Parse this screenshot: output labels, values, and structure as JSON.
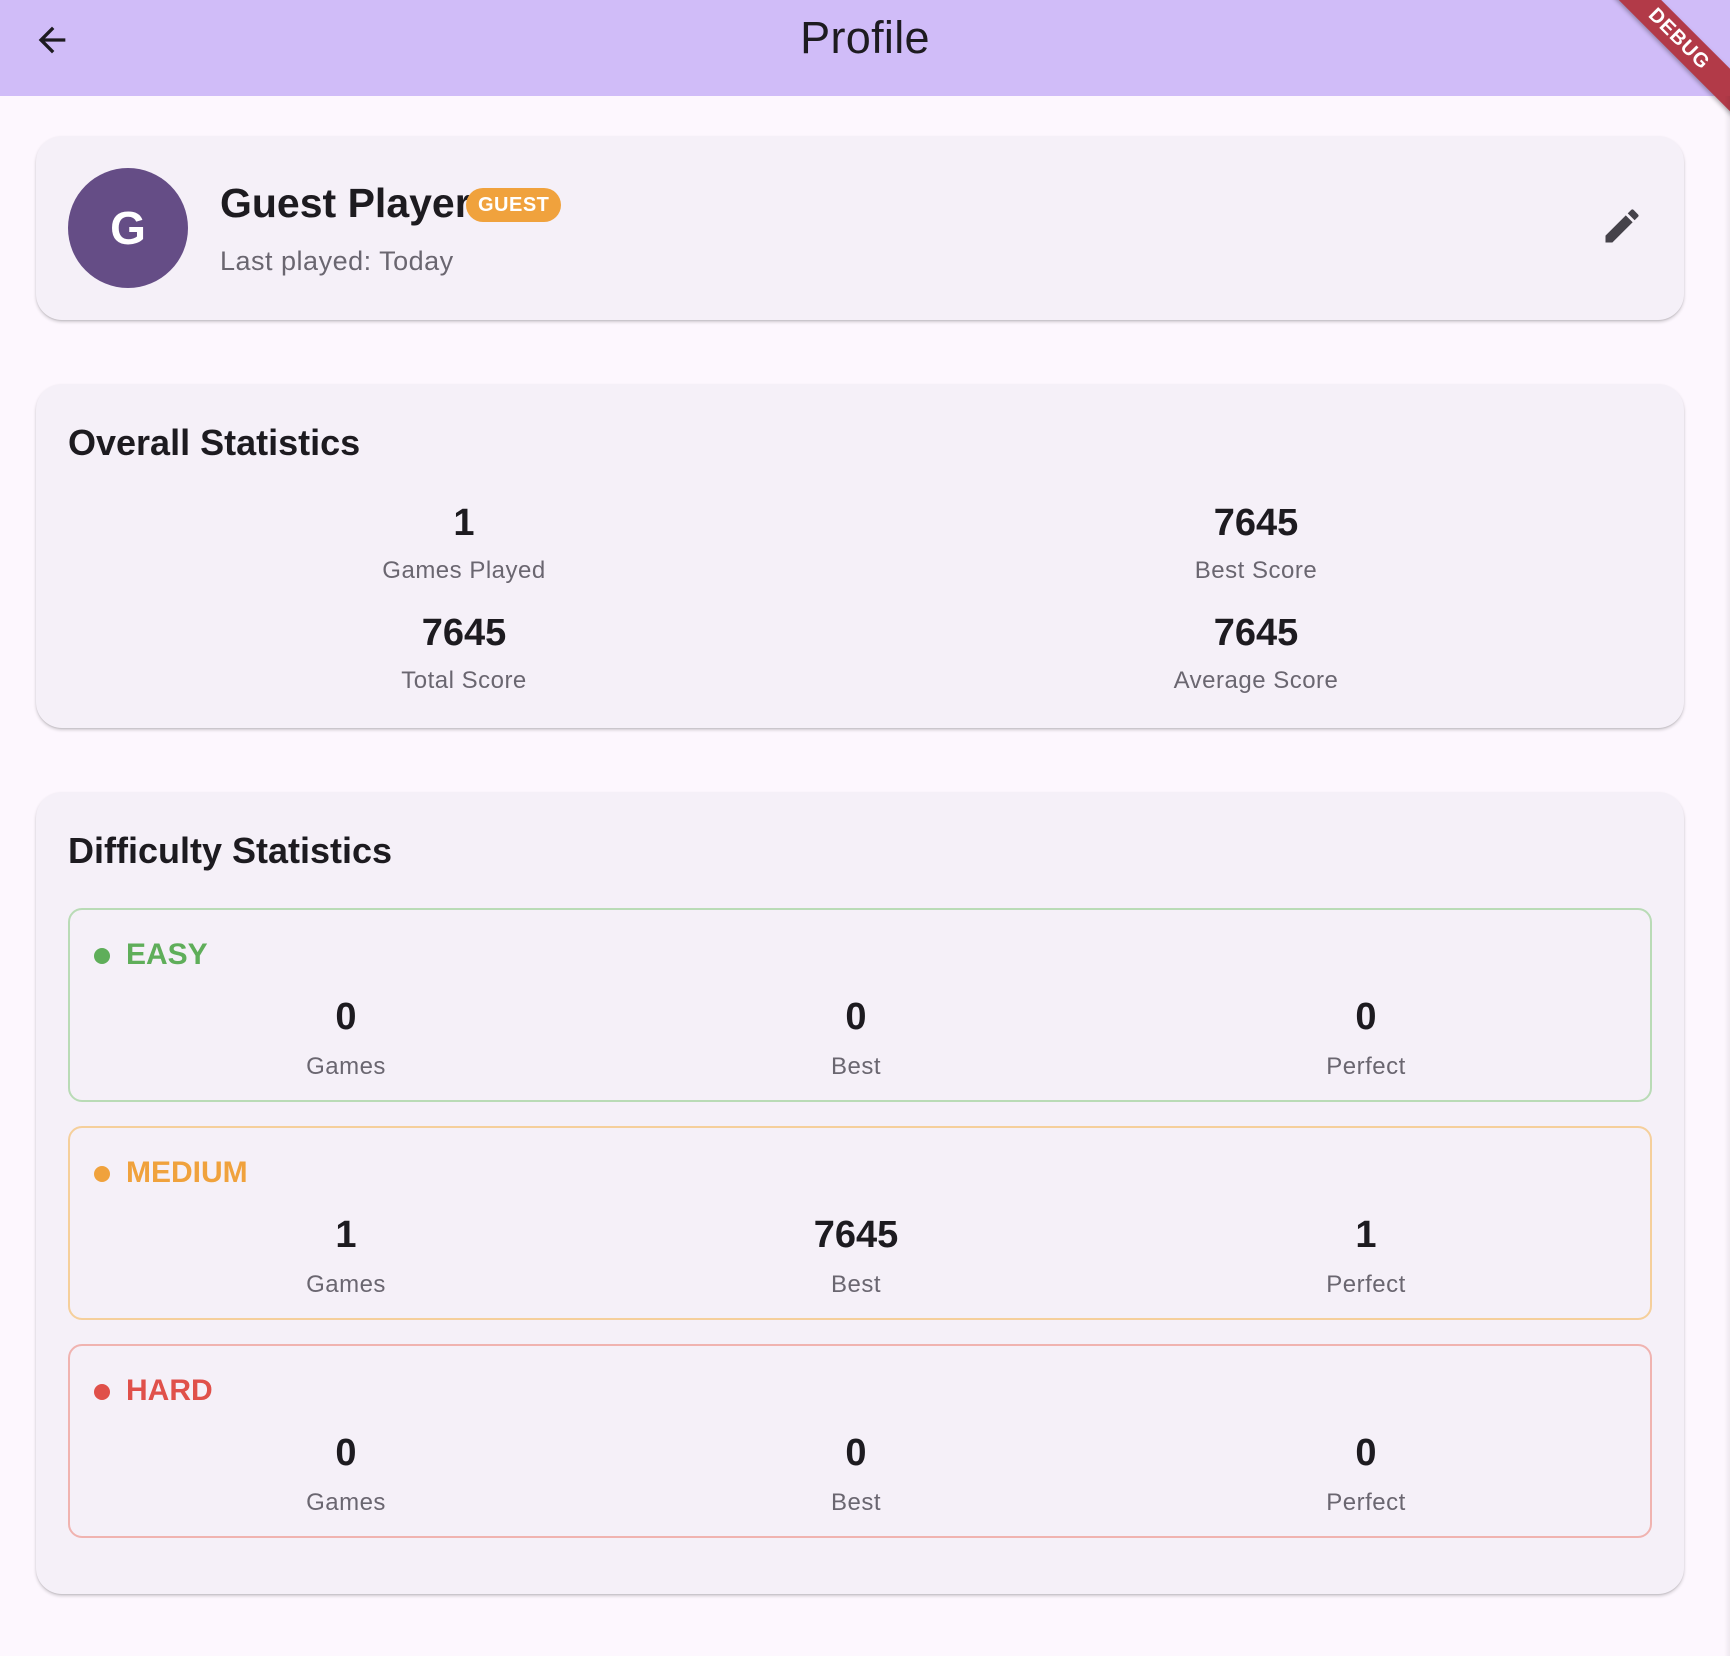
{
  "appbar": {
    "title": "Profile",
    "debug_label": "DEBUG",
    "back_icon": "arrow-back-icon"
  },
  "profile": {
    "avatar_initial": "G",
    "name": "Guest Player",
    "badge": "GUEST",
    "last_played": "Last played: Today",
    "edit_icon": "pencil-icon"
  },
  "overall": {
    "title": "Overall Statistics",
    "stats": [
      {
        "value": "1",
        "label": "Games Played"
      },
      {
        "value": "7645",
        "label": "Best Score"
      },
      {
        "value": "7645",
        "label": "Total Score"
      },
      {
        "value": "7645",
        "label": "Average Score"
      }
    ]
  },
  "difficulty": {
    "title": "Difficulty Statistics",
    "levels": [
      {
        "name": "EASY",
        "color": "#5fae5a",
        "stats": [
          {
            "value": "0",
            "label": "Games"
          },
          {
            "value": "0",
            "label": "Best"
          },
          {
            "value": "0",
            "label": "Perfect"
          }
        ]
      },
      {
        "name": "MEDIUM",
        "color": "#f0a23d",
        "stats": [
          {
            "value": "1",
            "label": "Games"
          },
          {
            "value": "7645",
            "label": "Best"
          },
          {
            "value": "1",
            "label": "Perfect"
          }
        ]
      },
      {
        "name": "HARD",
        "color": "#e0504a",
        "stats": [
          {
            "value": "0",
            "label": "Games"
          },
          {
            "value": "0",
            "label": "Best"
          },
          {
            "value": "0",
            "label": "Perfect"
          }
        ]
      }
    ]
  },
  "colors": {
    "appbar": "#d0bcf8",
    "avatar": "#654d86",
    "guest_badge": "#f0a23d",
    "background": "#fdf7fe",
    "card": "#f5f0f8"
  }
}
